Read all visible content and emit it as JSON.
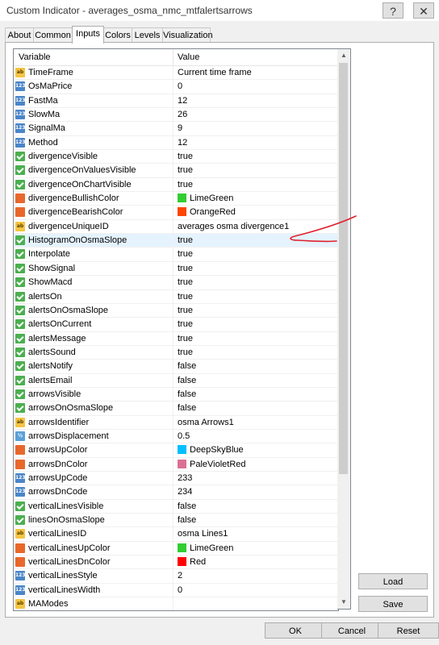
{
  "window": {
    "title": "Custom Indicator - averages_osma_nmc_mtfalertsarrows",
    "help": "?",
    "close": "✕"
  },
  "tabs": [
    "About",
    "Common",
    "Inputs",
    "Colors",
    "Levels",
    "Visualization"
  ],
  "active_tab": "Inputs",
  "grid": {
    "col_variable": "Variable",
    "col_value": "Value",
    "rows": [
      {
        "icon": "ab",
        "name": "TimeFrame",
        "value": "Current time frame"
      },
      {
        "icon": "123",
        "name": "OsMaPrice",
        "value": "0"
      },
      {
        "icon": "123",
        "name": "FastMa",
        "value": "12"
      },
      {
        "icon": "123",
        "name": "SlowMa",
        "value": "26"
      },
      {
        "icon": "123",
        "name": "SignalMa",
        "value": "9"
      },
      {
        "icon": "123",
        "name": "Method",
        "value": "12"
      },
      {
        "icon": "bool",
        "name": "divergenceVisible",
        "value": "true"
      },
      {
        "icon": "bool",
        "name": "divergenceOnValuesVisible",
        "value": "true"
      },
      {
        "icon": "bool",
        "name": "divergenceOnChartVisible",
        "value": "true"
      },
      {
        "icon": "color",
        "name": "divergenceBullishColor",
        "value": "LimeGreen",
        "swatch": "#32cd32"
      },
      {
        "icon": "color",
        "name": "divergenceBearishColor",
        "value": "OrangeRed",
        "swatch": "#ff4500"
      },
      {
        "icon": "ab",
        "name": "divergenceUniqueID",
        "value": "averages osma divergence1"
      },
      {
        "icon": "bool",
        "name": "HistogramOnOsmaSlope",
        "value": "true",
        "selected": true
      },
      {
        "icon": "bool",
        "name": "Interpolate",
        "value": "true"
      },
      {
        "icon": "bool",
        "name": "ShowSignal",
        "value": "true"
      },
      {
        "icon": "bool",
        "name": "ShowMacd",
        "value": "true"
      },
      {
        "icon": "bool",
        "name": "alertsOn",
        "value": "true"
      },
      {
        "icon": "bool",
        "name": "alertsOnOsmaSlope",
        "value": "true"
      },
      {
        "icon": "bool",
        "name": "alertsOnCurrent",
        "value": "true"
      },
      {
        "icon": "bool",
        "name": "alertsMessage",
        "value": "true"
      },
      {
        "icon": "bool",
        "name": "alertsSound",
        "value": "true"
      },
      {
        "icon": "bool",
        "name": "alertsNotify",
        "value": "false"
      },
      {
        "icon": "bool",
        "name": "alertsEmail",
        "value": "false"
      },
      {
        "icon": "bool",
        "name": "arrowsVisible",
        "value": "false"
      },
      {
        "icon": "bool",
        "name": "arrowsOnOsmaSlope",
        "value": "false"
      },
      {
        "icon": "ab",
        "name": "arrowsIdentifier",
        "value": "osma Arrows1"
      },
      {
        "icon": "half",
        "name": "arrowsDisplacement",
        "value": "0.5"
      },
      {
        "icon": "color",
        "name": "arrowsUpColor",
        "value": "DeepSkyBlue",
        "swatch": "#00bfff"
      },
      {
        "icon": "color",
        "name": "arrowsDnColor",
        "value": "PaleVioletRed",
        "swatch": "#db7093"
      },
      {
        "icon": "123",
        "name": "arrowsUpCode",
        "value": "233"
      },
      {
        "icon": "123",
        "name": "arrowsDnCode",
        "value": "234"
      },
      {
        "icon": "bool",
        "name": "verticalLinesVisible",
        "value": "false"
      },
      {
        "icon": "bool",
        "name": "linesOnOsmaSlope",
        "value": "false"
      },
      {
        "icon": "ab",
        "name": "verticalLinesID",
        "value": "osma Lines1"
      },
      {
        "icon": "color",
        "name": "verticalLinesUpColor",
        "value": "LimeGreen",
        "swatch": "#32cd32"
      },
      {
        "icon": "color",
        "name": "verticalLinesDnColor",
        "value": "Red",
        "swatch": "#ff0000"
      },
      {
        "icon": "123",
        "name": "verticalLinesStyle",
        "value": "2"
      },
      {
        "icon": "123",
        "name": "verticalLinesWidth",
        "value": "0"
      },
      {
        "icon": "ab",
        "name": "MAModes",
        "value": ""
      }
    ]
  },
  "side_buttons": {
    "load": "Load",
    "save": "Save"
  },
  "footer_buttons": {
    "ok": "OK",
    "cancel": "Cancel",
    "reset": "Reset"
  },
  "annotation_color": "#e0202e"
}
